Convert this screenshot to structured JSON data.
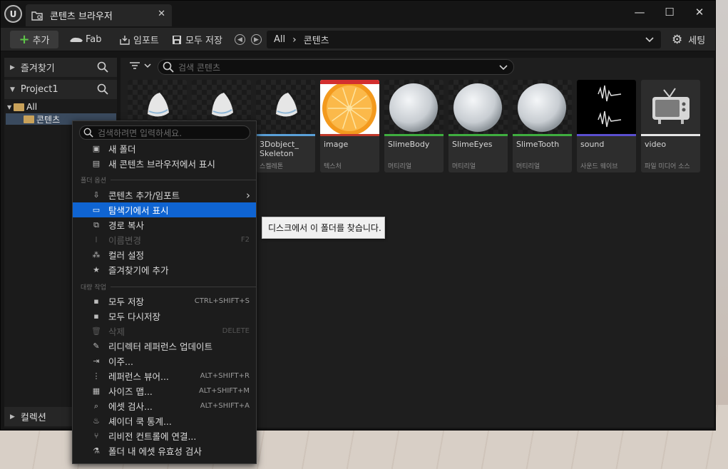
{
  "window": {
    "tab_title": "콘텐츠 브라우저",
    "tab_close": "✕",
    "minimize": "—",
    "maximize": "☐",
    "close": "✕"
  },
  "toolbar": {
    "add_label": "추가",
    "fab_label": "Fab",
    "import_label": "임포트",
    "save_all_label": "모두 저장",
    "path_root": "All",
    "path_current": "콘텐츠",
    "settings_label": "세팅"
  },
  "left_panel": {
    "favorites_label": "즐겨찾기",
    "project_label": "Project1",
    "tree_all": "All",
    "tree_content": "콘텐츠",
    "collections_label": "컬렉션"
  },
  "content": {
    "search_placeholder": "검색 콘텐츠",
    "assets": [
      {
        "name": "",
        "type": "",
        "bar_color": "#5aa0d8"
      },
      {
        "name": "",
        "type": "",
        "bar_color": "#5aa0d8"
      },
      {
        "name": "3Dobject_ Skeleton",
        "type": "스켈레톤",
        "bar_color": "#5aa0d8"
      },
      {
        "name": "image",
        "type": "텍스처",
        "bar_color": "#c0392b"
      },
      {
        "name": "SlimeBody",
        "type": "머티리얼",
        "bar_color": "#3fae3f"
      },
      {
        "name": "SlimeEyes",
        "type": "머티리얼",
        "bar_color": "#3fae3f"
      },
      {
        "name": "SlimeTooth",
        "type": "머티리얼",
        "bar_color": "#3fae3f"
      },
      {
        "name": "sound",
        "type": "사운드 웨이브",
        "bar_color": "#5b4fcf"
      },
      {
        "name": "video",
        "type": "파일 미디어 소스",
        "bar_color": "#e6e6e6"
      }
    ]
  },
  "context_menu": {
    "search_placeholder": "검색하려면 입력하세요.",
    "new_folder": "새 폴더",
    "show_in_new_browser": "새 콘텐츠 브라우저에서 표시",
    "section_folder_options": "폴더 옵션",
    "add_import": "콘텐츠 추가/임포트",
    "show_in_explorer": "탐색기에서 표시",
    "copy_path": "경로 복사",
    "rename": "이름변경",
    "rename_shortcut": "F2",
    "set_color": "컬러 설정",
    "add_to_favorites": "즐겨찾기에 추가",
    "section_bulk_ops": "대량 작업",
    "save_all": "모두 저장",
    "save_all_shortcut": "CTRL+SHIFT+S",
    "resave_all": "모두 다시저장",
    "delete": "삭제",
    "delete_shortcut": "DELETE",
    "fixup_redirectors": "리디렉터 레퍼런스 업데이트",
    "move": "이주...",
    "reference_viewer": "레퍼런스 뷰어...",
    "reference_viewer_shortcut": "ALT+SHIFT+R",
    "size_map": "사이즈 맵...",
    "size_map_shortcut": "ALT+SHIFT+M",
    "audit_assets": "에셋 검사...",
    "audit_assets_shortcut": "ALT+SHIFT+A",
    "shader_cook_stats": "셰이더 쿡 통계...",
    "connect_source_control": "리비전 컨트롤에 연결...",
    "validate_assets": "폴더 내 에셋 유효성 검사"
  },
  "tooltip": {
    "text": "디스크에서 이 폴더를 찾습니다."
  }
}
